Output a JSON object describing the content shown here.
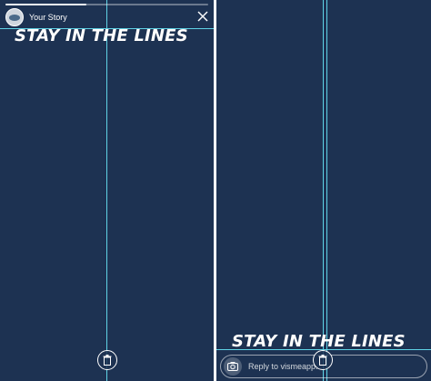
{
  "left_panel": {
    "header": {
      "username": "Your Story",
      "progress_fraction": 0.4
    },
    "caption": "STAY IN THE LINES",
    "icons": {
      "avatar": "avatar-image",
      "close": "close-icon",
      "trash": "trash-icon"
    }
  },
  "right_panel": {
    "caption": "STAY IN THE LINES",
    "reply": {
      "placeholder": "Reply to vismeapp..."
    },
    "icons": {
      "camera": "camera-icon",
      "trash": "trash-icon"
    }
  },
  "colors": {
    "background": "#1d3252",
    "guide_line": "#5fd3e6",
    "text": "#ffffff"
  }
}
